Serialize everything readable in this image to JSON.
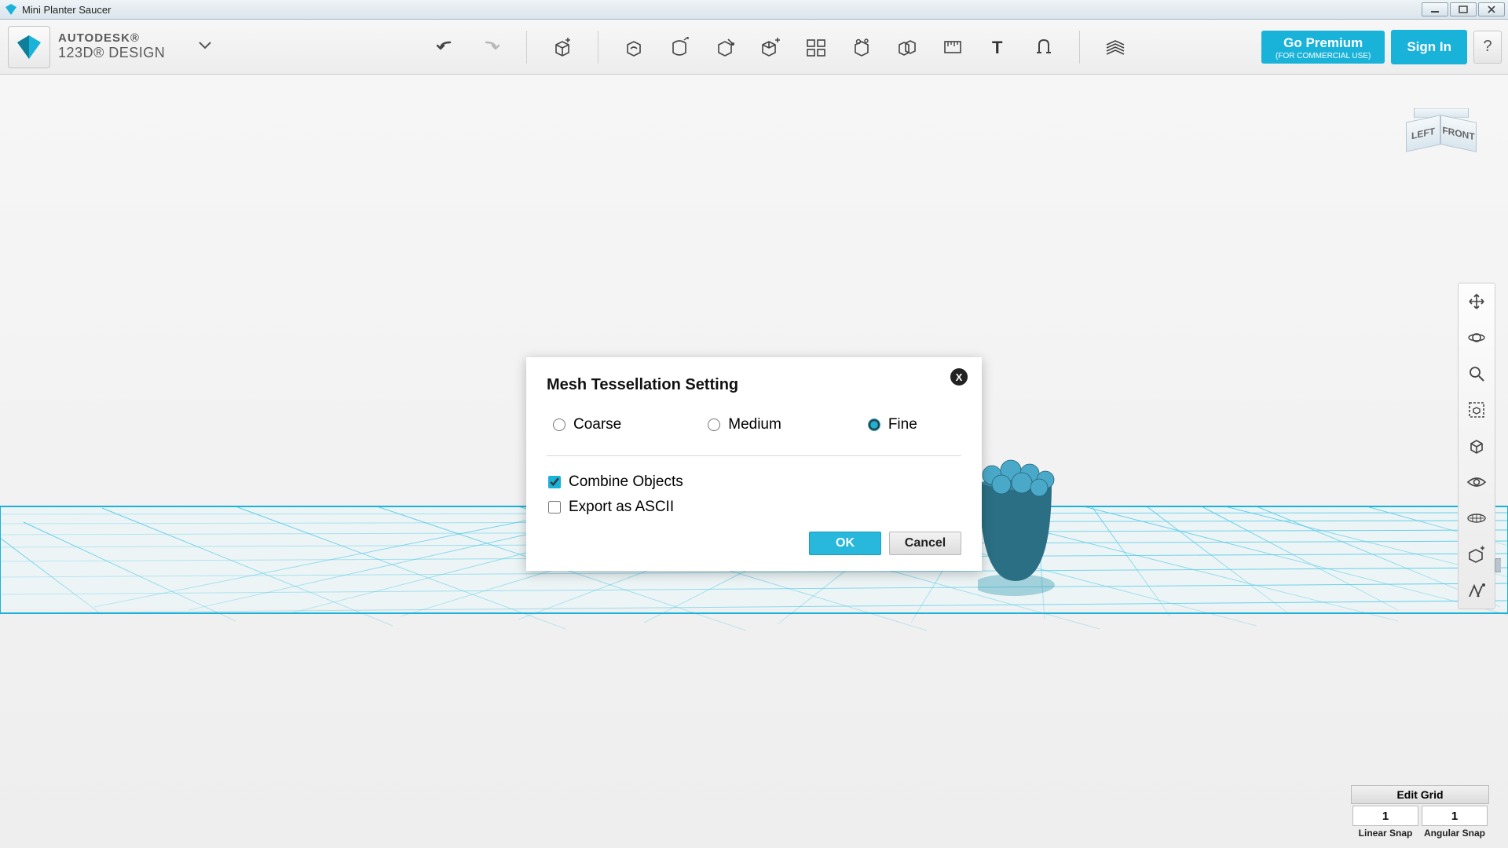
{
  "window": {
    "title": "Mini Planter Saucer"
  },
  "brand": {
    "line1": "AUTODESK®",
    "line2": "123D® DESIGN"
  },
  "header_buttons": {
    "premium_label": "Go Premium",
    "premium_sub": "(FOR COMMERCIAL USE)",
    "signin_label": "Sign In",
    "help_label": "?"
  },
  "viewcube": {
    "left": "LEFT",
    "front": "FRONT"
  },
  "snap": {
    "edit_grid": "Edit Grid",
    "linear_value": "1",
    "angular_value": "1",
    "linear_label": "Linear Snap",
    "angular_label": "Angular Snap"
  },
  "dialog": {
    "title": "Mesh Tessellation Setting",
    "options": {
      "coarse": "Coarse",
      "medium": "Medium",
      "fine": "Fine"
    },
    "selected": "fine",
    "combine_label": "Combine Objects",
    "combine_checked": true,
    "ascii_label": "Export as ASCII",
    "ascii_checked": false,
    "ok": "OK",
    "cancel": "Cancel"
  },
  "colors": {
    "accent": "#19b2d9",
    "grid": "#4fc9e6"
  }
}
